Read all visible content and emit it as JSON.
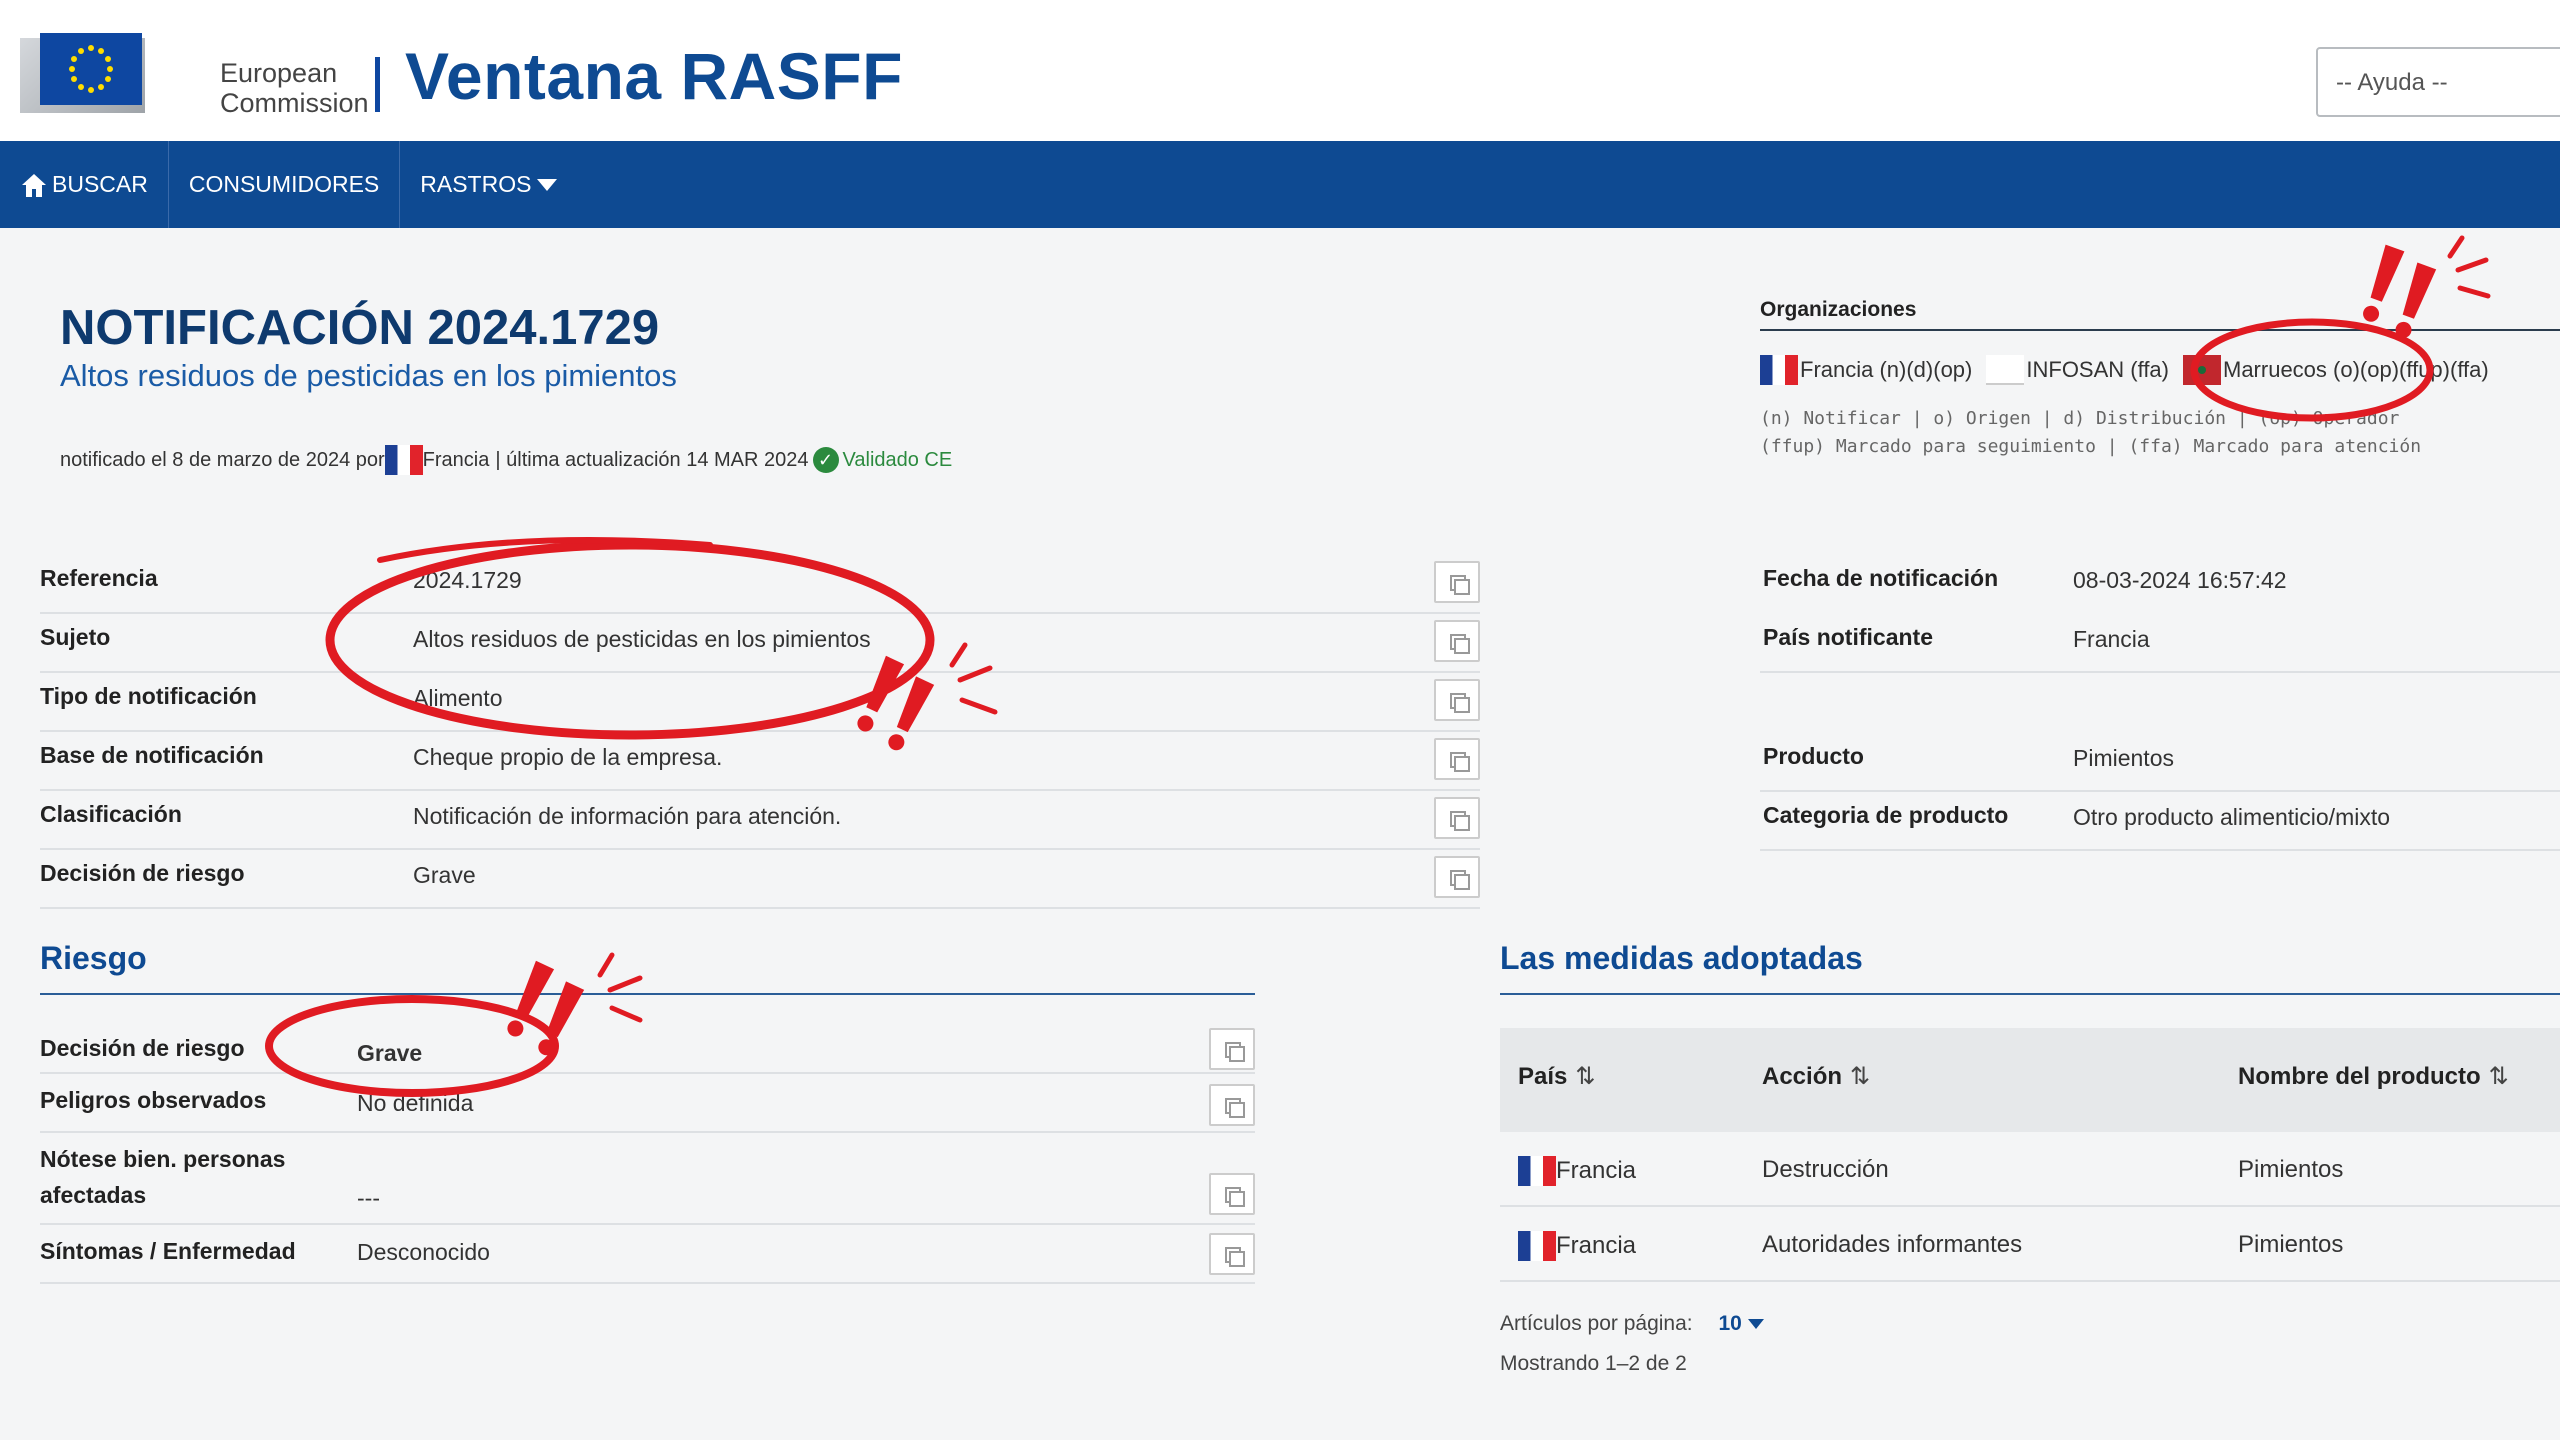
{
  "header": {
    "logo_line1": "European",
    "logo_line2": "Commission",
    "app_title": "Ventana RASFF",
    "help_select": "-- Ayuda --"
  },
  "nav": {
    "items": [
      {
        "label": "BUSCAR",
        "icon": "home-icon"
      },
      {
        "label": "CONSUMIDORES"
      },
      {
        "label": "RASTROS",
        "icon": "caret-down-icon"
      }
    ]
  },
  "notification": {
    "title": "NOTIFICACIÓN 2024.1729",
    "subtitle": "Altos residuos de pesticidas en los pimientos",
    "meta_prefix": "notificado el 8 de marzo de 2024 por",
    "meta_country": "Francia",
    "meta_updated": "| última actualización 14 MAR 2024",
    "validated": "Validado CE"
  },
  "organizations": {
    "title": "Organizaciones",
    "items": [
      {
        "flag": "france-flag",
        "label": "Francia (n)(d)(op)"
      },
      {
        "flag": "blank-flag",
        "label": "INFOSAN (ffa)"
      },
      {
        "flag": "morocco-flag",
        "label": "Marruecos (o)(op)(ffup)(ffa)"
      }
    ],
    "legend_line1": "(n) Notificar | o) Origen | d) Distribución | (op) Operador",
    "legend_line2": "(ffup) Marcado para seguimiento | (ffa) Marcado para atención"
  },
  "details_left": [
    {
      "label": "Referencia",
      "value": "2024.1729"
    },
    {
      "label": "Sujeto",
      "value": "Altos residuos de pesticidas en los pimientos"
    },
    {
      "label": "Tipo de notificación",
      "value": "Alimento"
    },
    {
      "label": "Base de notificación",
      "value": "Cheque propio de la empresa."
    },
    {
      "label": "Clasificación",
      "value": "Notificación de información para atención."
    },
    {
      "label": "Decisión de riesgo",
      "value": "Grave"
    }
  ],
  "details_right": [
    {
      "label": "Fecha de notificación",
      "value": "08-03-2024 16:57:42"
    },
    {
      "label": "País notificante",
      "value": "Francia"
    },
    {
      "label": "Producto",
      "value": "Pimientos"
    },
    {
      "label": "Categoria de producto",
      "value": "Otro producto alimenticio/mixto"
    }
  ],
  "riesgo": {
    "title": "Riesgo",
    "rows": [
      {
        "label": "Decisión de riesgo",
        "value": "Grave"
      },
      {
        "label": "Peligros observados",
        "value": "No definida"
      },
      {
        "label": "Nótese bien. personas afectadas",
        "value": "---"
      },
      {
        "label": "Síntomas / Enfermedad",
        "value": "Desconocido"
      }
    ]
  },
  "medidas": {
    "title": "Las medidas adoptadas",
    "columns": [
      "País",
      "Acción",
      "Nombre del producto"
    ],
    "rows": [
      {
        "country": "Francia",
        "action": "Destrucción",
        "product": "Pimientos"
      },
      {
        "country": "Francia",
        "action": "Autoridades informantes",
        "product": "Pimientos"
      }
    ],
    "per_page_label": "Artículos por página:",
    "per_page_value": "10",
    "showing": "Mostrando 1–2 de 2"
  },
  "colors": {
    "brand_blue": "#0e4a92",
    "annotation_red": "#e01b22",
    "validated_green": "#2b8a3e"
  }
}
